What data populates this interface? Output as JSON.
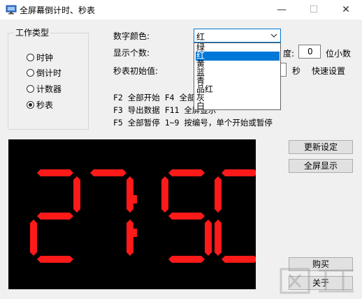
{
  "window": {
    "title": "全屏幕倒计时、秒表",
    "minimize_glyph": "—",
    "maximize_glyph": "☐",
    "close_glyph": "✕"
  },
  "mode_group": {
    "label": "工作类型",
    "options": [
      {
        "label": "时钟",
        "selected": false
      },
      {
        "label": "倒计时",
        "selected": false
      },
      {
        "label": "计数器",
        "selected": false
      },
      {
        "label": "秒表",
        "selected": true
      }
    ]
  },
  "settings": {
    "digit_color_label": "数字颜色:",
    "digit_color_value": "红",
    "digit_color_options": [
      "绿",
      "红",
      "黄",
      "蓝",
      "青",
      "品红",
      "灰",
      "白"
    ],
    "digit_color_selected_index": 1,
    "digit_count_label": "显示个数:",
    "precision_label_fragment": "度:",
    "precision_value": "0",
    "precision_unit": "位小数",
    "stopwatch_start_label": "秒表初始值:",
    "stopwatch_start_unit": "秒",
    "quick_settings_label": "快速设置"
  },
  "help_lines": [
    "F2 全部开始 F4 全部",
    "F3 导出数据 F11 全屏显示",
    "F5 全部暂停 1~9 按编号，单个开始或暂停"
  ],
  "buttons": {
    "update": "更新设定",
    "fullscreen": "全屏显示",
    "buy": "购买",
    "about": "关于"
  },
  "display": {
    "time": "27:50",
    "digit_color": "#ff1a1a",
    "background": "#000000"
  },
  "colors": {
    "accent": "#0078d7"
  }
}
